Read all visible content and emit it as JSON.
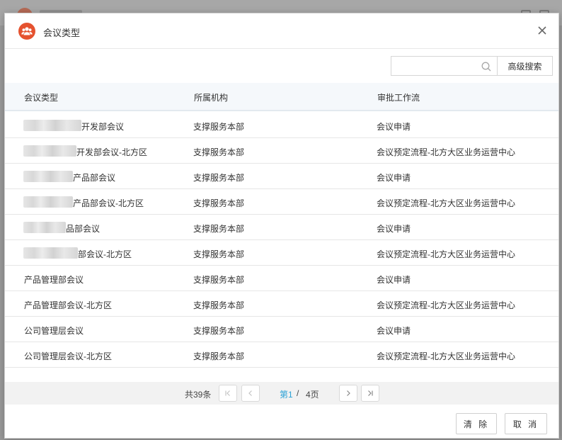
{
  "dialog": {
    "title": "会议类型",
    "icon": "meeting-group-icon",
    "accent": "#e5522f"
  },
  "search": {
    "placeholder": "",
    "value": "",
    "advanced_label": "高级搜索"
  },
  "table": {
    "columns": [
      "会议类型",
      "所属机构",
      "审批工作流"
    ],
    "rows": [
      {
        "name": "开发部会议",
        "org": "支撑服务本部",
        "flow": "会议申请"
      },
      {
        "name": "开发部会议-北方区",
        "org": "支撑服务本部",
        "flow": "会议预定流程-北方大区业务运营中心"
      },
      {
        "name": "产品部会议",
        "org": "支撑服务本部",
        "flow": "会议申请"
      },
      {
        "name": "产品部会议-北方区",
        "org": "支撑服务本部",
        "flow": "会议预定流程-北方大区业务运营中心"
      },
      {
        "name": "品部会议",
        "org": "支撑服务本部",
        "flow": "会议申请"
      },
      {
        "name": "部会议-北方区",
        "org": "支撑服务本部",
        "flow": "会议预定流程-北方大区业务运营中心"
      },
      {
        "name": "产品管理部会议",
        "org": "支撑服务本部",
        "flow": "会议申请"
      },
      {
        "name": "产品管理部会议-北方区",
        "org": "支撑服务本部",
        "flow": "会议预定流程-北方大区业务运营中心"
      },
      {
        "name": "公司管理层会议",
        "org": "支撑服务本部",
        "flow": "会议申请"
      },
      {
        "name": "公司管理层会议-北方区",
        "org": "支撑服务本部",
        "flow": "会议预定流程-北方大区业务运营中心"
      }
    ]
  },
  "pager": {
    "total": "共39条",
    "current": "第1",
    "separator": "/",
    "pages": "4页",
    "current_color": "#2aa1d6"
  },
  "footer": {
    "clear_label": "清 除",
    "cancel_label": "取 消"
  }
}
